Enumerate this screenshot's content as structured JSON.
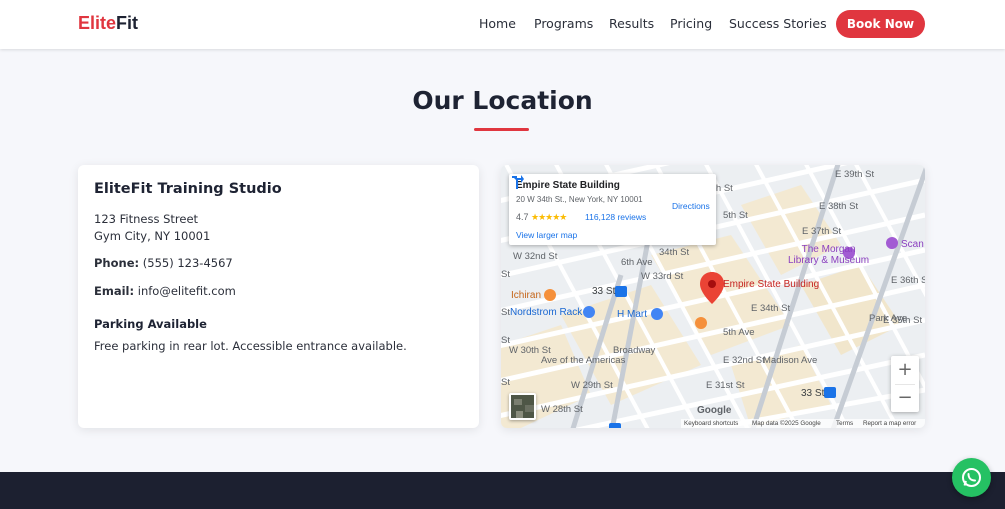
{
  "header": {
    "logo_part1": "Elite",
    "logo_part2": "Fit",
    "nav": [
      "Home",
      "Programs",
      "Results",
      "Pricing",
      "Success Stories"
    ],
    "cta": "Book Now"
  },
  "location": {
    "title": "Our Location",
    "studio_name": "EliteFit Training Studio",
    "address_line1": "123 Fitness Street",
    "address_line2": "Gym City, NY 10001",
    "phone_label": "Phone:",
    "phone": "(555) 123-4567",
    "email_label": "Email:",
    "email": "info@elitefit.com",
    "parking_title": "Parking Available",
    "parking_text": "Free parking in rear lot. Accessible entrance available."
  },
  "map": {
    "place_name": "Empire State Building",
    "place_address": "20 W 34th St., New York, NY 10001",
    "rating": "4.7",
    "stars": "★★★★★",
    "reviews": "116,128 reviews",
    "directions": "Directions",
    "view_larger": "View larger map",
    "marker_label": "Empire State Building",
    "zoom_in": "+",
    "zoom_out": "−",
    "google": "Google",
    "attribution": [
      "Keyboard shortcuts",
      "Map data ©2025 Google",
      "Terms",
      "Report a map error"
    ],
    "pois": {
      "morgan": "The Morgan\nLibrary & Museum",
      "ichiran": "Ichiran",
      "nordstrom": "Nordstrom Rack",
      "hmart": "H Mart",
      "station_33": "33 St",
      "station_33b": "33 St",
      "scan": "Scan"
    },
    "streets": {
      "e39": "E 39th St",
      "e38": "E 38th St",
      "e37": "E 37th St",
      "e36": "E 36th St",
      "e35": "E 35th St",
      "e34": "E 34th St",
      "e32": "E 32nd St",
      "e31": "E 31st St",
      "w34": "34th St",
      "w33": "W 33rd St",
      "w32": "W 32nd St",
      "w30": "W 30th St",
      "w29": "W 29th St",
      "w28": "W 28th St",
      "st_6": "6th St",
      "st_5": "5th St",
      "ave_5": "5th Ave",
      "ave_6": "6th Ave",
      "ave_madison": "Madison Ave",
      "ave_park": "Park Ave",
      "ave_amer": "Ave of the Americas",
      "broadway": "Broadway",
      "st_a": "St",
      "st_b": "St",
      "st_c": "St",
      "st_d": "St"
    }
  },
  "colors": {
    "accent": "#e0363f",
    "dark": "#1e2333",
    "footer": "#1c2030",
    "whatsapp": "#25c163"
  }
}
